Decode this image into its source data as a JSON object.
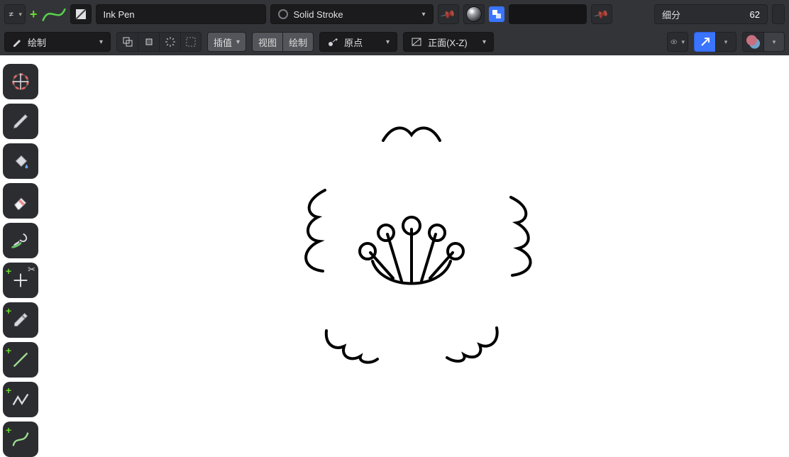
{
  "topbar": {
    "brush_field_value": "Ink Pen",
    "stroke_field_value": "Solid Stroke",
    "subdiv_label": "细分",
    "subdiv_value": "62"
  },
  "toolbar": {
    "mode_label": "绘制",
    "interp_label": "插值",
    "view_label": "视图",
    "draw_label": "绘制",
    "origin_label": "原点",
    "plane_label": "正面(X-Z)"
  },
  "tools": {
    "cursor": "cursor-3d",
    "pencil": "pencil",
    "fill": "fill-bucket",
    "erase": "eraser",
    "tint": "tint-brush",
    "cutter": "cutter",
    "eyedrop": "eyedropper",
    "line": "draw-line",
    "polyline": "draw-polyline",
    "curve": "draw-curve"
  }
}
